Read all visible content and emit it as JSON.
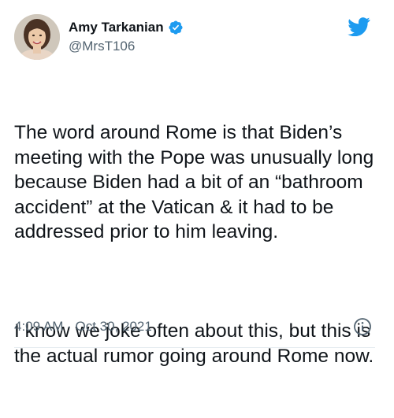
{
  "tweet": {
    "author": {
      "display_name": "Amy Tarkanian",
      "handle": "@MrsT106",
      "verified_icon": "verified-badge-icon",
      "avatar": "profile-photo"
    },
    "platform_icon": "twitter-bird-icon",
    "paragraphs": [
      "The word around Rome is that Biden’s meeting with the Pope was unusually long because Biden had a bit of an “bathroom accident” at the Vatican & it had to be addressed prior to him leaving.",
      "I know we joke often about this, but this is the actual rumor going around Rome now."
    ],
    "timestamp": "4:09 AM · Oct 30, 2021",
    "info_icon": "info-icon"
  },
  "colors": {
    "text": "#0f1419",
    "secondary_text": "#536471",
    "twitter_blue": "#1d9bf0",
    "divider": "#e6ecf0"
  }
}
